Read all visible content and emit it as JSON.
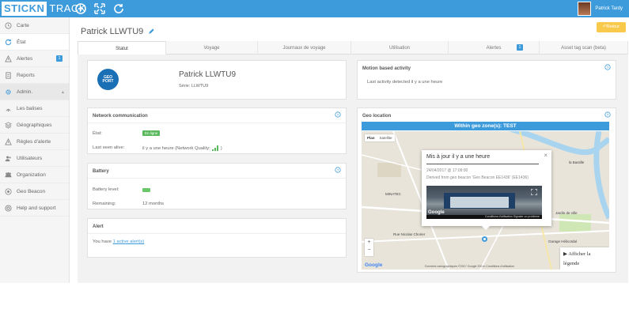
{
  "header": {
    "logo_left": "STICKN",
    "logo_right": "TRACK",
    "user_name": "Patrick Tardy"
  },
  "sidebar": {
    "items": [
      {
        "label": "Carte",
        "icon": "clock-icon"
      },
      {
        "label": "État",
        "icon": "refresh-icon"
      },
      {
        "label": "Alertes",
        "icon": "warning-icon",
        "badge": "1"
      },
      {
        "label": "Reports",
        "icon": "document-icon"
      },
      {
        "label": "Admin.",
        "icon": "gear-icon"
      },
      {
        "label": "Les balises",
        "icon": "signal-icon"
      },
      {
        "label": "Géographiques",
        "icon": "layers-icon"
      },
      {
        "label": "Règles d'alerte",
        "icon": "warning-icon"
      },
      {
        "label": "Utilisateurs",
        "icon": "users-icon"
      },
      {
        "label": "Organization",
        "icon": "group-icon"
      },
      {
        "label": "Geo Beacon",
        "icon": "beacon-icon"
      },
      {
        "label": "Help and support",
        "icon": "lifebuoy-icon"
      }
    ]
  },
  "page": {
    "title": "Patrick LLWTU9",
    "return_label": "Retour"
  },
  "tabs": [
    {
      "label": "Statut"
    },
    {
      "label": "Voyage"
    },
    {
      "label": "Journaux de voyage"
    },
    {
      "label": "Utilisation"
    },
    {
      "label": "Alertes",
      "badge": "1"
    },
    {
      "label": "Asset tag scan (beta)"
    }
  ],
  "device": {
    "logo_line1": "GEO",
    "logo_line2": "PORT",
    "name": "Patrick LLWTU9",
    "serial": "Série: LLWTU9"
  },
  "motion": {
    "title": "Motion based activity",
    "text": "Last activity detected il y a une heure"
  },
  "network": {
    "title": "Network communication",
    "state_label": "État:",
    "state_value": "En ligne",
    "last_seen_label": "Last seen alive:",
    "last_seen_value": "il y a une heure (Network Quality:"
  },
  "battery": {
    "title": "Battery",
    "level_label": "Battery level:",
    "remaining_label": "Remaining:",
    "remaining_value": "12 months"
  },
  "alert": {
    "title": "Alert",
    "text_prefix": "You have",
    "link": "1 active alert(s)"
  },
  "geo": {
    "title": "Geo location",
    "banner": "Within geo zone(s): TEST",
    "map_plan": "Plan",
    "map_satellite": "Satellite",
    "labels": {
      "bastille": "la Bastille",
      "minatec": "MINATEC",
      "gare": "Gare de Grenoble",
      "jardin": "Jardin de ville",
      "halle": "Garage Hélicoïdal",
      "rue": "Rue Nicolas Chorier"
    },
    "zoom_in": "+",
    "zoom_out": "−",
    "google": "Google",
    "footer": "Données cartographiques ©2017 Google   200 m   Conditions d'utilisation",
    "legend_line1": "Afficher la",
    "legend_line2": "légende"
  },
  "infowindow": {
    "title": "Mis à jour il y a une heure",
    "date": "24/04/2017 @ 17:09:00",
    "desc": "Derived from geo beacon 'Geo Beacon EE1436' (EE1436)",
    "photo_footer": "Conditions d'utilisation  Signaler un problème",
    "photo_google": "Google"
  },
  "colors": {
    "primary": "#3d9bdc",
    "warning": "#f9c94b",
    "success": "#5cb85c"
  }
}
